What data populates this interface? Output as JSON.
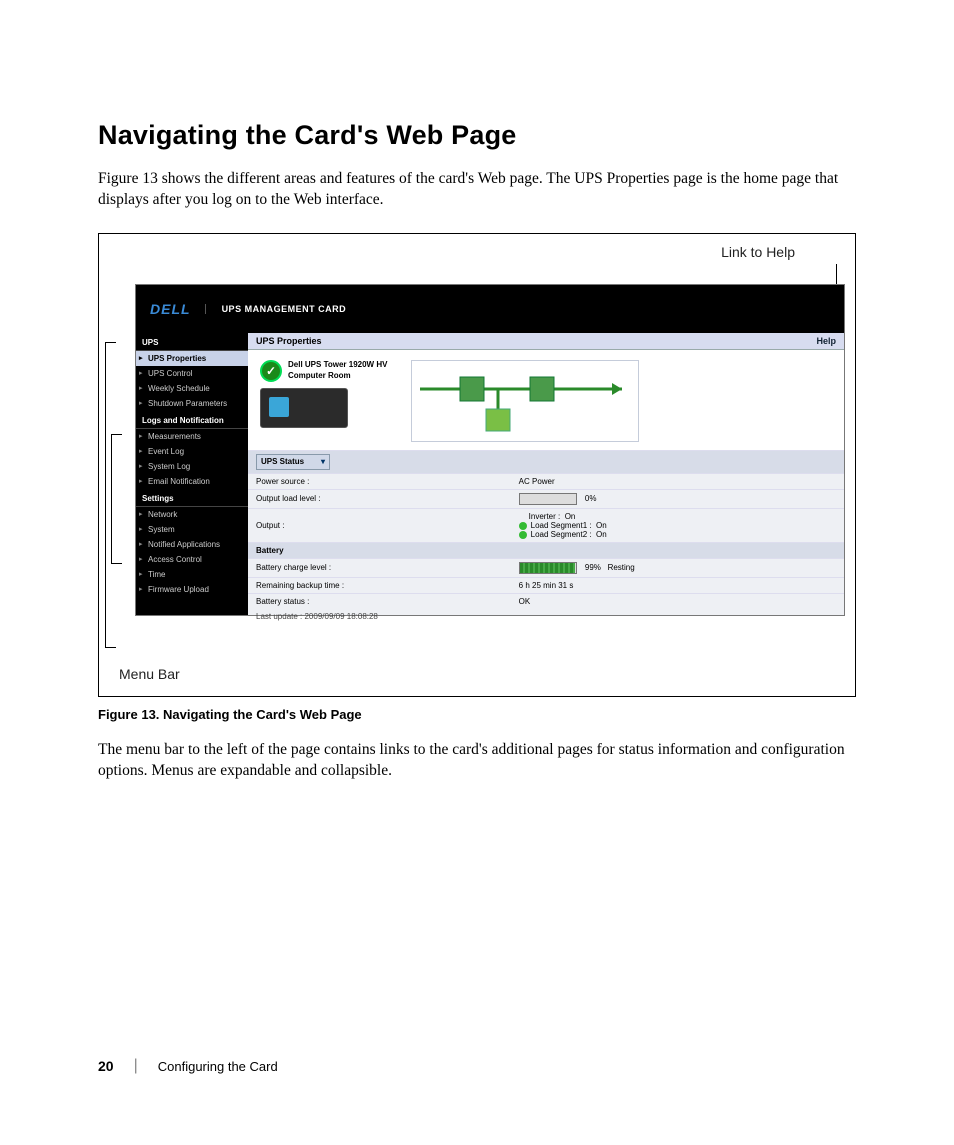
{
  "heading": "Navigating the Card's Web Page",
  "para1": "Figure 13 shows the different areas and features of the card's Web page. The UPS Properties page is the home page that displays after you log on to the Web interface.",
  "callouts": {
    "top": "Link to Help",
    "bottom": "Menu Bar"
  },
  "app": {
    "brand": "DELL",
    "title": "UPS MANAGEMENT CARD",
    "contentTitle": "UPS Properties",
    "help": "Help",
    "device": {
      "name": "Dell UPS Tower 1920W HV",
      "room": "Computer Room"
    },
    "sidebar": {
      "g1": "UPS",
      "g1items": [
        "UPS Properties",
        "UPS Control",
        "Weekly Schedule",
        "Shutdown Parameters"
      ],
      "g2": "Logs and Notification",
      "g2items": [
        "Measurements",
        "Event Log",
        "System Log",
        "Email Notification"
      ],
      "g3": "Settings",
      "g3items": [
        "Network",
        "System",
        "Notified Applications",
        "Access Control",
        "Time",
        "Firmware Upload"
      ]
    },
    "status": {
      "selLabel": "UPS Status",
      "rows": {
        "powerSourceL": "Power source :",
        "powerSourceV": "AC Power",
        "outLoadL": "Output load level :",
        "outLoadV": "0%",
        "outLoadPct": 0,
        "outputL": "Output :",
        "inverterL": "Inverter :",
        "inverterV": "On",
        "ls1L": "Load Segment1 :",
        "ls1V": "On",
        "ls2L": "Load Segment2 :",
        "ls2V": "On",
        "batteryHdr": "Battery",
        "chargeL": "Battery charge level :",
        "chargeV": "99%",
        "chargeState": "Resting",
        "chargePct": 99,
        "remainL": "Remaining backup time :",
        "remainV": "6 h 25 min 31 s",
        "bstatL": "Battery status :",
        "bstatV": "OK",
        "updated": "Last update : 2009/09/09 18:08:28"
      }
    }
  },
  "figcap": "Figure 13. Navigating the Card's Web Page",
  "para2": "The menu bar to the left of the page contains links to the card's additional pages for status information and configuration options. Menus are expandable and collapsible.",
  "footer": {
    "page": "20",
    "section": "Configuring the Card"
  }
}
